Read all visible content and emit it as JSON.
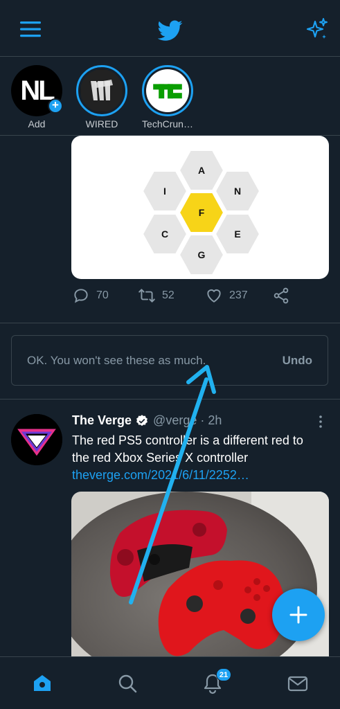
{
  "colors": {
    "background": "#15202b",
    "accent": "#1da1f2",
    "muted": "#8899a6",
    "border": "#38444d"
  },
  "topbar": {
    "menu_icon": "hamburger-menu-icon",
    "logo_icon": "twitter-bird-icon",
    "sparkle_icon": "sparkle-top-tweets-icon"
  },
  "fleets": [
    {
      "label": "Add",
      "avatar_text": "NL"
    },
    {
      "label": "WIRED"
    },
    {
      "label": "TechCrun…"
    }
  ],
  "puzzle": {
    "letters": [
      "A",
      "I",
      "N",
      "F",
      "C",
      "E",
      "G"
    ],
    "center": "F"
  },
  "tweet1": {
    "replies": "70",
    "retweets": "52",
    "likes": "237"
  },
  "toast": {
    "message": "OK. You won't see these as much.",
    "undo_label": "Undo"
  },
  "tweet2": {
    "name": "The Verge",
    "handle": "@verge",
    "time": "2h",
    "text": "The red PS5 controller is a different red to the red Xbox Series X controller",
    "link": "theverge.com/2021/6/11/2252…",
    "replies": "",
    "retweets": "",
    "likes": ""
  },
  "bottom_nav": {
    "notifications_badge": "21",
    "items": [
      "home-icon",
      "search-icon",
      "notifications-icon",
      "messages-icon"
    ]
  }
}
